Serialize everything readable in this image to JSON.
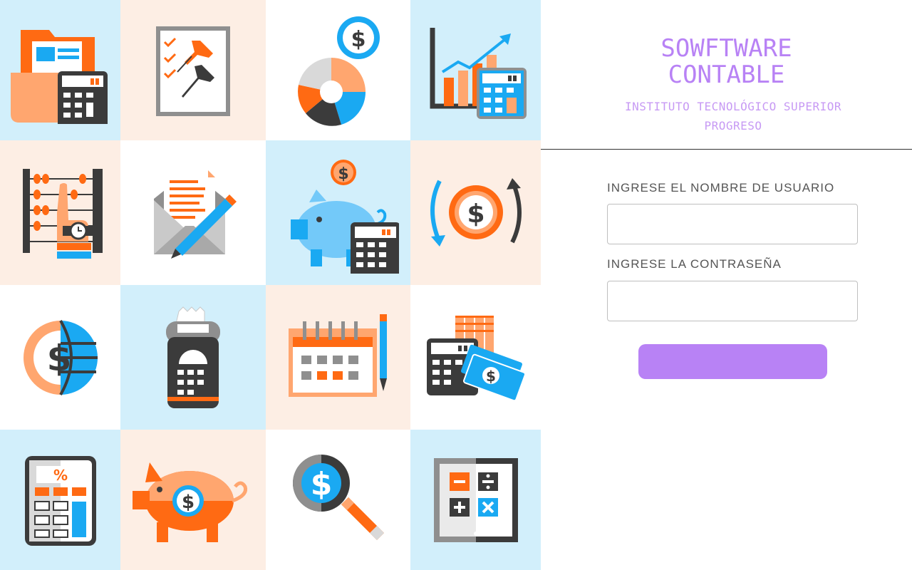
{
  "brand": {
    "title": "SOWFTWARE CONTABLE",
    "subtitle": "INSTITUTO TECNOLÓGICO SUPERIOR PROGRESO"
  },
  "login": {
    "username_label": "INGRESE EL NOMBRE DE USUARIO",
    "username_value": "",
    "password_label": "INGRESE LA CONTRASEÑA",
    "password_value": "",
    "submit_label": ""
  },
  "colors": {
    "accent": "#b882f5",
    "tile_blue": "#d2effb",
    "tile_peach": "#fdeee4",
    "icon_orange": "#ff6a13",
    "icon_blue": "#1aa9f2",
    "icon_dark": "#3b3b3b"
  },
  "illustration": {
    "icons": [
      "folder-calculator-icon",
      "checklist-pins-icon",
      "pie-chart-dollar-icon",
      "growth-chart-calculator-icon",
      "abacus-hand-icon",
      "envelope-pen-icon",
      "piggy-bank-calculator-icon",
      "dollar-exchange-icon",
      "dollar-globe-icon",
      "card-terminal-icon",
      "calendar-pen-icon",
      "calculator-money-icon",
      "percent-calculator-icon",
      "piggy-bank-dollar-icon",
      "dollar-magnifier-icon",
      "math-operations-icon"
    ]
  }
}
